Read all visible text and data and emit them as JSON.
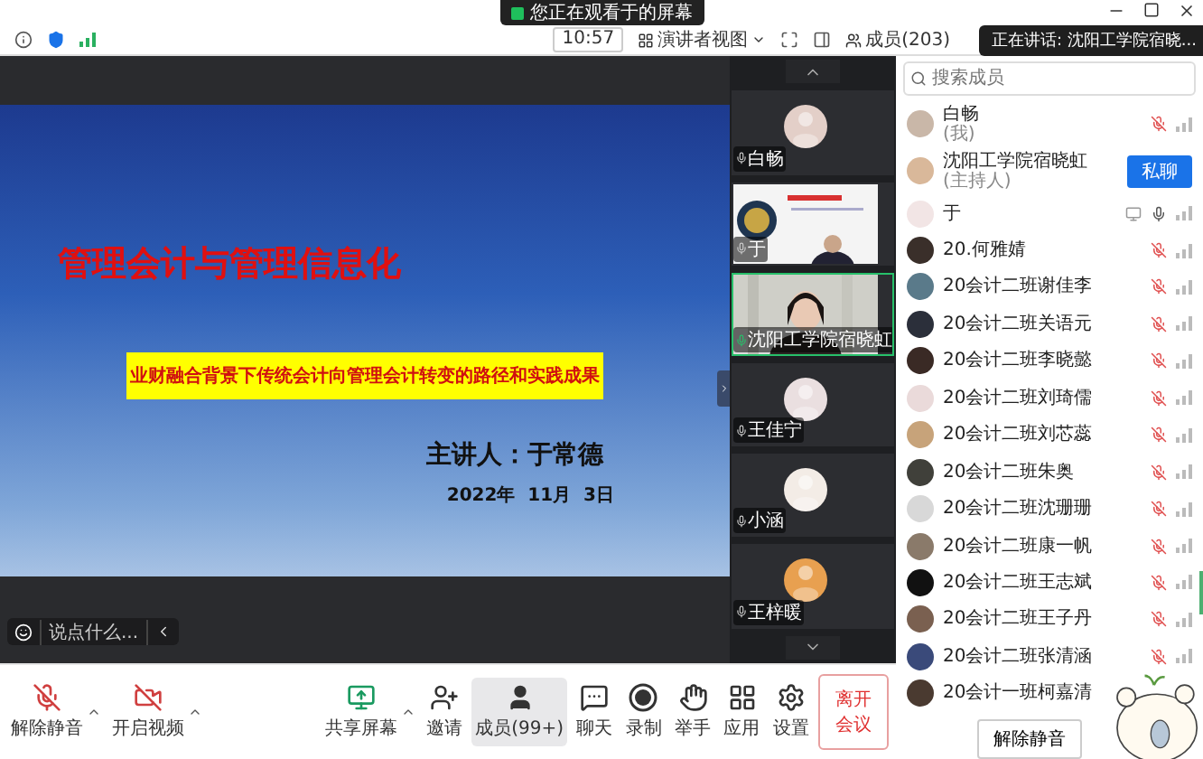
{
  "top_banner": {
    "text": "您正在观看于的屏幕"
  },
  "toolbar": {
    "time": "10:57",
    "view": "演讲者视图",
    "members": "成员(203)"
  },
  "speaking_notice": {
    "text": "正在讲话: 沈阳工学院宿晓..."
  },
  "slide": {
    "title": "管理会计与管理信息化",
    "subtitle": "业财融合背景下传统会计向管理会计转变的路径和实践成果",
    "speaker": "主讲人：于常德",
    "date": "2022年  11月  3日"
  },
  "reaction_bar": {
    "placeholder": "说点什么..."
  },
  "video_tiles": [
    {
      "name": "白畅",
      "kind": "avatar",
      "speaking": false
    },
    {
      "name": "于",
      "kind": "screen",
      "speaking": false
    },
    {
      "name": "沈阳工学院宿晓虹",
      "kind": "video",
      "speaking": true
    },
    {
      "name": "王佳宁",
      "kind": "avatar",
      "speaking": false
    },
    {
      "name": "小涵",
      "kind": "avatar",
      "speaking": false
    },
    {
      "name": "王梓暖",
      "kind": "avatar",
      "speaking": false
    }
  ],
  "controls": [
    {
      "kind": "mic",
      "label": "解除静音",
      "off": true,
      "has_menu": true,
      "selected": false
    },
    {
      "kind": "camera",
      "label": "开启视频",
      "off": true,
      "has_menu": true,
      "selected": false
    },
    {
      "kind": "share",
      "label": "共享屏幕",
      "has_menu": true,
      "selected": false
    },
    {
      "kind": "invite",
      "label": "邀请",
      "has_menu": false,
      "selected": false
    },
    {
      "kind": "members",
      "label": "成员(99+)",
      "has_menu": false,
      "selected": true
    },
    {
      "kind": "chat",
      "label": "聊天",
      "has_menu": false,
      "selected": false
    },
    {
      "kind": "record",
      "label": "录制",
      "has_menu": false,
      "selected": false
    },
    {
      "kind": "hand",
      "label": "举手",
      "has_menu": false,
      "selected": false
    },
    {
      "kind": "apps",
      "label": "应用",
      "has_menu": false,
      "selected": false
    },
    {
      "kind": "settings",
      "label": "设置",
      "has_menu": false,
      "selected": false
    }
  ],
  "leave_button": "离开会议",
  "member_panel": {
    "search": {
      "placeholder": "搜索成员"
    },
    "members": [
      {
        "name": "白畅",
        "note": "(我)",
        "muted": true,
        "sharing": false
      },
      {
        "name": "沈阳工学院宿晓虹",
        "note": "(主持人)",
        "action": "私聊"
      },
      {
        "name": "于",
        "muted": false,
        "sharing": true
      },
      {
        "name": "20.何雅婧",
        "muted": true,
        "sharing": false
      },
      {
        "name": "20会计二班谢佳李",
        "muted": true,
        "sharing": false
      },
      {
        "name": "20会计二班关语元",
        "muted": true,
        "sharing": false
      },
      {
        "name": "20会计二班李晓懿",
        "muted": true,
        "sharing": false
      },
      {
        "name": "20会计二班刘琦儒",
        "muted": true,
        "sharing": false
      },
      {
        "name": "20会计二班刘芯蕊",
        "muted": true,
        "sharing": false
      },
      {
        "name": "20会计二班朱奥",
        "muted": true,
        "sharing": false
      },
      {
        "name": "20会计二班沈珊珊",
        "muted": true,
        "sharing": false
      },
      {
        "name": "20会计二班康一帆",
        "muted": true,
        "sharing": false
      },
      {
        "name": "20会计二班王志斌",
        "muted": true,
        "sharing": false
      },
      {
        "name": "20会计二班王子丹",
        "muted": true,
        "sharing": false
      },
      {
        "name": "20会计二班张清涵",
        "muted": true,
        "sharing": false
      },
      {
        "name": "20会计一班柯嘉清"
      }
    ],
    "footer_button": "解除静音"
  }
}
